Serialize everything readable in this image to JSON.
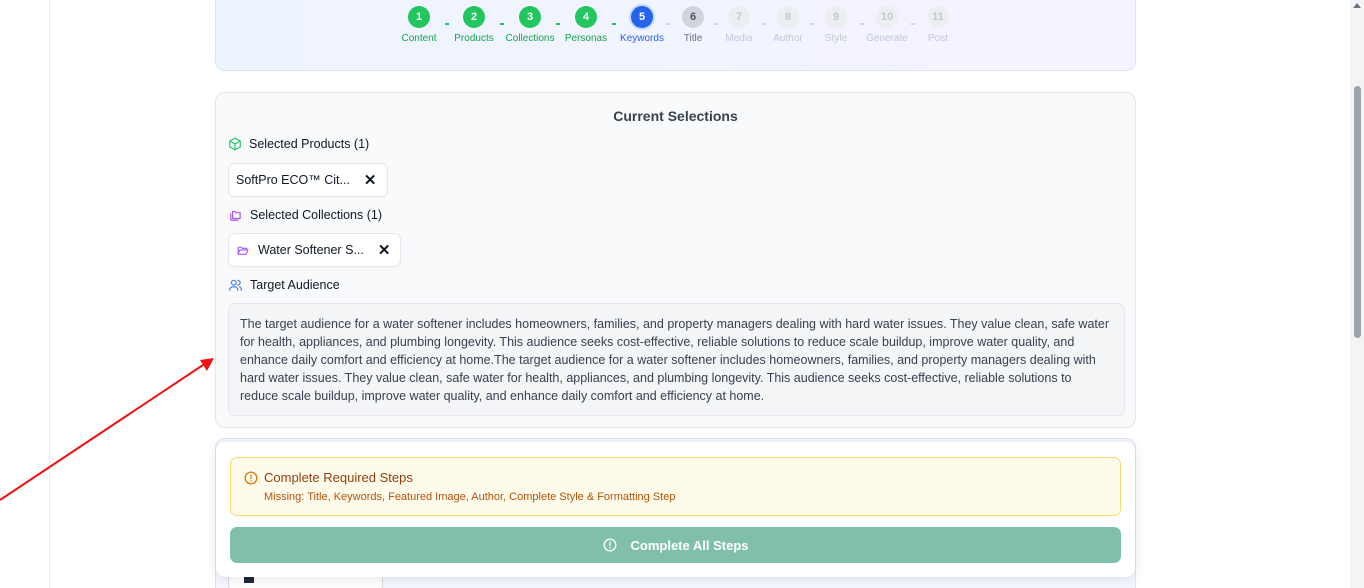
{
  "stepper": {
    "steps": [
      {
        "number": "1",
        "label": "Content",
        "state": "done"
      },
      {
        "number": "2",
        "label": "Products",
        "state": "done"
      },
      {
        "number": "3",
        "label": "Collections",
        "state": "done"
      },
      {
        "number": "4",
        "label": "Personas",
        "state": "done"
      },
      {
        "number": "5",
        "label": "Keywords",
        "state": "active"
      },
      {
        "number": "6",
        "label": "Title",
        "state": "next"
      },
      {
        "number": "7",
        "label": "Media",
        "state": "future"
      },
      {
        "number": "8",
        "label": "Author",
        "state": "future"
      },
      {
        "number": "9",
        "label": "Style",
        "state": "future"
      },
      {
        "number": "10",
        "label": "Generate",
        "state": "future"
      },
      {
        "number": "11",
        "label": "Post",
        "state": "future"
      }
    ]
  },
  "selections": {
    "title": "Current Selections",
    "products_heading": "Selected Products (1)",
    "products": [
      "SoftPro ECO™ Cit..."
    ],
    "collections_heading": "Selected Collections (1)",
    "collections": [
      "Water Softener S..."
    ],
    "audience_heading": "Target Audience",
    "audience_text": "The target audience for a water softener includes homeowners, families, and property managers dealing with hard water issues. They value clean, safe water for health, appliances, and plumbing longevity. This audience seeks cost-effective, reliable solutions to reduce scale buildup, improve water quality, and enhance daily comfort and efficiency at home.The target audience for a water softener includes homeowners, families, and property managers dealing with hard water issues. They value clean, safe water for health, appliances, and plumbing longevity. This audience seeks cost-effective, reliable solutions to reduce scale buildup, improve water quality, and enhance daily comfort and efficiency at home.",
    "remove_symbol": "✕"
  },
  "bottom_panel": {
    "warning_title": "Complete Required Steps",
    "warning_missing": "Missing: Title, Keywords, Featured Image, Author, Complete Style & Formatting Step",
    "button_label": "Complete All Steps"
  },
  "colors": {
    "done": "#22c55e",
    "active": "#2563eb",
    "warning_bg": "#fffbeb",
    "button_bg": "#80c0a9",
    "annotation_arrow": "#ee1111"
  },
  "icons": {
    "products": "package-icon",
    "collections": "folders-icon",
    "collection_chip": "folder-open-icon",
    "audience": "users-icon",
    "warning": "alert-circle-icon"
  }
}
